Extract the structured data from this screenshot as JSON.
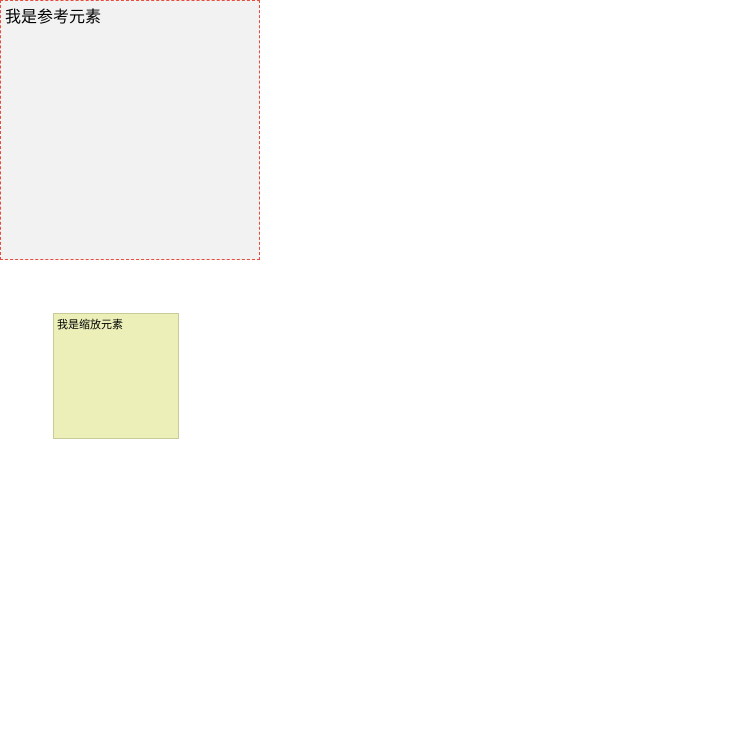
{
  "reference": {
    "label": "我是参考元素"
  },
  "scaled": {
    "label": "我是缩放元素"
  }
}
